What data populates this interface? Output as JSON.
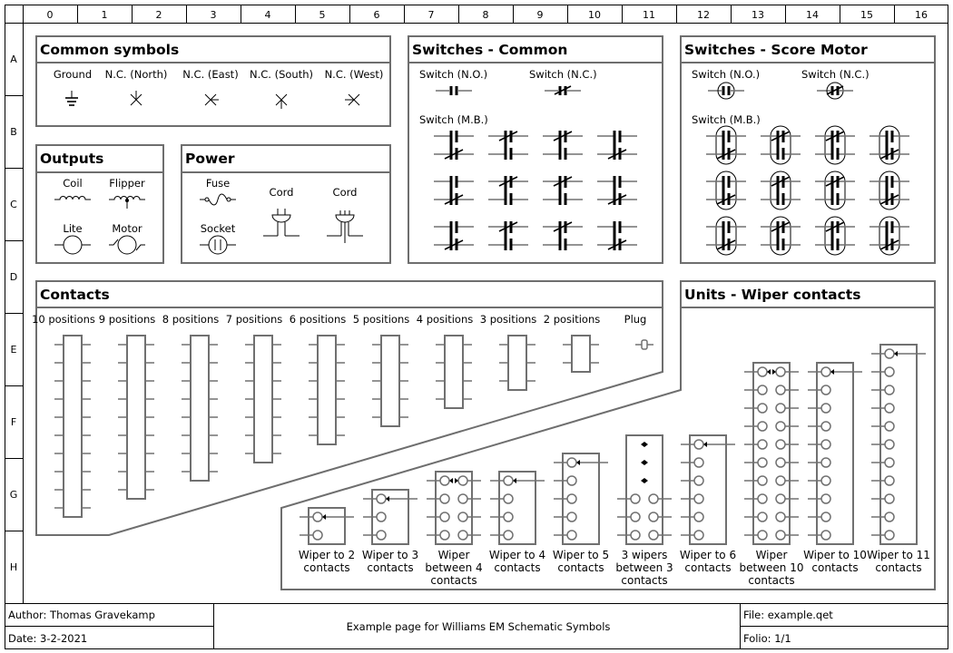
{
  "grid": {
    "columns": [
      "0",
      "1",
      "2",
      "3",
      "4",
      "5",
      "6",
      "7",
      "8",
      "9",
      "10",
      "11",
      "12",
      "13",
      "14",
      "15",
      "16"
    ],
    "rows": [
      "A",
      "B",
      "C",
      "D",
      "E",
      "F",
      "G",
      "H"
    ]
  },
  "sections": {
    "common": {
      "title": "Common symbols",
      "items": [
        {
          "label": "Ground",
          "icon": "ground-icon"
        },
        {
          "label": "N.C. (North)",
          "icon": "nc-north-icon"
        },
        {
          "label": "N.C. (East)",
          "icon": "nc-east-icon"
        },
        {
          "label": "N.C. (South)",
          "icon": "nc-south-icon"
        },
        {
          "label": "N.C. (West)",
          "icon": "nc-west-icon"
        }
      ]
    },
    "switches_common": {
      "title": "Switches - Common",
      "no_label": "Switch (N.O.)",
      "nc_label": "Switch (N.C.)",
      "mb_label": "Switch (M.B.)"
    },
    "switches_score": {
      "title": "Switches - Score Motor",
      "no_label": "Switch (N.O.)",
      "nc_label": "Switch (N.C.)",
      "mb_label": "Switch (M.B.)"
    },
    "outputs": {
      "title": "Outputs",
      "items": [
        {
          "label": "Coil",
          "icon": "coil-icon"
        },
        {
          "label": "Flipper",
          "icon": "flipper-coil-icon"
        },
        {
          "label": "Lite",
          "icon": "lamp-icon"
        },
        {
          "label": "Motor",
          "icon": "motor-icon"
        }
      ]
    },
    "power": {
      "title": "Power",
      "items": [
        {
          "label": "Fuse",
          "icon": "fuse-icon"
        },
        {
          "label": "Socket",
          "icon": "socket-icon"
        },
        {
          "label": "Cord",
          "icon": "cord-2prong-icon"
        },
        {
          "label": "Cord",
          "icon": "cord-3prong-icon"
        }
      ]
    },
    "contacts": {
      "title": "Contacts",
      "items": [
        {
          "label": "10 positions",
          "positions": 10
        },
        {
          "label": "9 positions",
          "positions": 9
        },
        {
          "label": "8 positions",
          "positions": 8
        },
        {
          "label": "7 positions",
          "positions": 7
        },
        {
          "label": "6 positions",
          "positions": 6
        },
        {
          "label": "5 positions",
          "positions": 5
        },
        {
          "label": "4 positions",
          "positions": 4
        },
        {
          "label": "3 positions",
          "positions": 3
        },
        {
          "label": "2 positions",
          "positions": 2
        },
        {
          "label": "Plug",
          "positions": 1
        }
      ]
    },
    "wipers": {
      "title": "Units - Wiper contacts",
      "items": [
        {
          "lines": [
            "Wiper to 2",
            "contacts"
          ],
          "type": "single",
          "contacts": 2
        },
        {
          "lines": [
            "Wiper to 3",
            "contacts"
          ],
          "type": "single",
          "contacts": 3
        },
        {
          "lines": [
            "Wiper",
            "between 4",
            "contacts"
          ],
          "type": "between",
          "contacts": 4
        },
        {
          "lines": [
            "Wiper to 4",
            "contacts"
          ],
          "type": "single",
          "contacts": 4
        },
        {
          "lines": [
            "Wiper to 5",
            "contacts"
          ],
          "type": "single",
          "contacts": 5
        },
        {
          "lines": [
            "3 wipers",
            "between 3",
            "contacts"
          ],
          "type": "three",
          "contacts": 3
        },
        {
          "lines": [
            "Wiper to 6",
            "contacts"
          ],
          "type": "single",
          "contacts": 6
        },
        {
          "lines": [
            "Wiper",
            "between 10",
            "contacts"
          ],
          "type": "between",
          "contacts": 10
        },
        {
          "lines": [
            "Wiper to 10",
            "contacts"
          ],
          "type": "single",
          "contacts": 10
        },
        {
          "lines": [
            "Wiper to 11",
            "contacts"
          ],
          "type": "single",
          "contacts": 11
        }
      ]
    }
  },
  "footer": {
    "author": "Author: Thomas Gravekamp",
    "date": "Date: 3-2-2021",
    "title": "Example page for Williams EM Schematic Symbols",
    "file": "File: example.qet",
    "folio": "Folio: 1/1"
  }
}
